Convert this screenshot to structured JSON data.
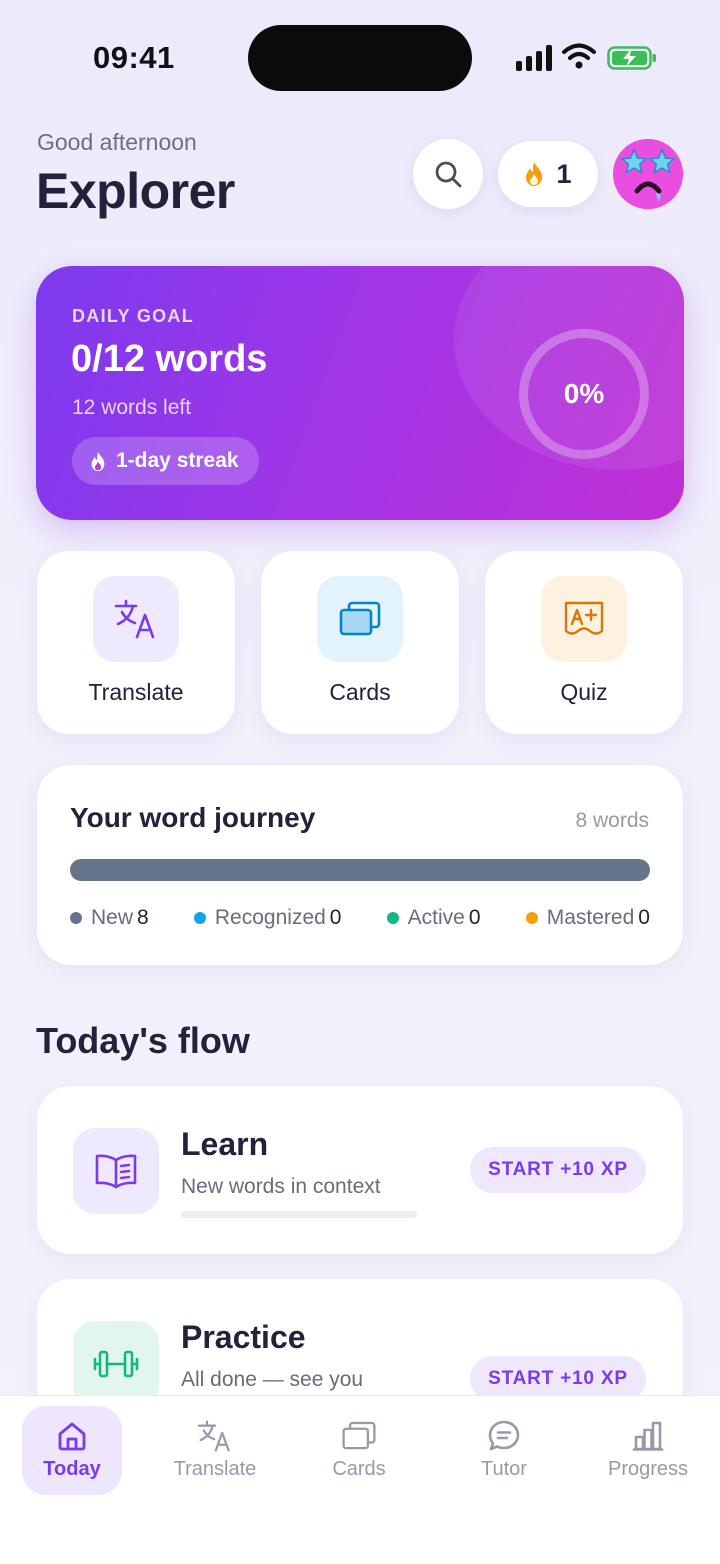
{
  "status_bar": {
    "time": "09:41"
  },
  "header": {
    "greeting": "Good afternoon",
    "user_name": "Explorer",
    "streak_count": "1",
    "icons": {
      "search": "search-icon",
      "streak": "flame-icon",
      "avatar": "star-eyes-emoji-avatar"
    }
  },
  "daily_goal": {
    "label": "DAILY GOAL",
    "value": "0/12 words",
    "remaining": "12 words left",
    "streak": "1-day streak",
    "percent": "0%",
    "progress_fraction": 0
  },
  "quick_actions": [
    {
      "label": "Translate",
      "icon": "translate-icon",
      "color": "#7c3aed",
      "bg": "#efe9fd"
    },
    {
      "label": "Cards",
      "icon": "cards-icon",
      "color": "#0284c7",
      "bg": "#e2f3fc"
    },
    {
      "label": "Quiz",
      "icon": "quiz-icon",
      "color": "#d97706",
      "bg": "#fdf1e0"
    }
  ],
  "journey": {
    "title": "Your word journey",
    "count": "8 words",
    "legend": [
      {
        "label": "New",
        "value": "8",
        "color": "#667489"
      },
      {
        "label": "Recognized",
        "value": "0",
        "color": "#0ea5e9"
      },
      {
        "label": "Active",
        "value": "0",
        "color": "#10b981"
      },
      {
        "label": "Mastered",
        "value": "0",
        "color": "#f59e0b"
      }
    ]
  },
  "flow": {
    "heading": "Today's flow",
    "items": [
      {
        "title": "Learn",
        "subtitle": "New words in context",
        "button": "START +10 XP",
        "icon": "book-icon",
        "color": "#7c3aed",
        "bg": "#efe9fd"
      },
      {
        "title": "Practice",
        "subtitle": "All done — see you",
        "button": "START +10 XP",
        "icon": "dumbbell-icon",
        "color": "#10b981",
        "bg": "#e3f6ee"
      }
    ]
  },
  "bottom_nav": [
    {
      "label": "Today",
      "icon": "home-icon",
      "active": true
    },
    {
      "label": "Translate",
      "icon": "translate-icon",
      "active": false
    },
    {
      "label": "Cards",
      "icon": "cards-icon",
      "active": false
    },
    {
      "label": "Tutor",
      "icon": "chat-icon",
      "active": false
    },
    {
      "label": "Progress",
      "icon": "bar-chart-icon",
      "active": false
    }
  ],
  "colors": {
    "accent": "#7c3aed",
    "text": "#23223a",
    "muted": "#6b6a7e"
  }
}
